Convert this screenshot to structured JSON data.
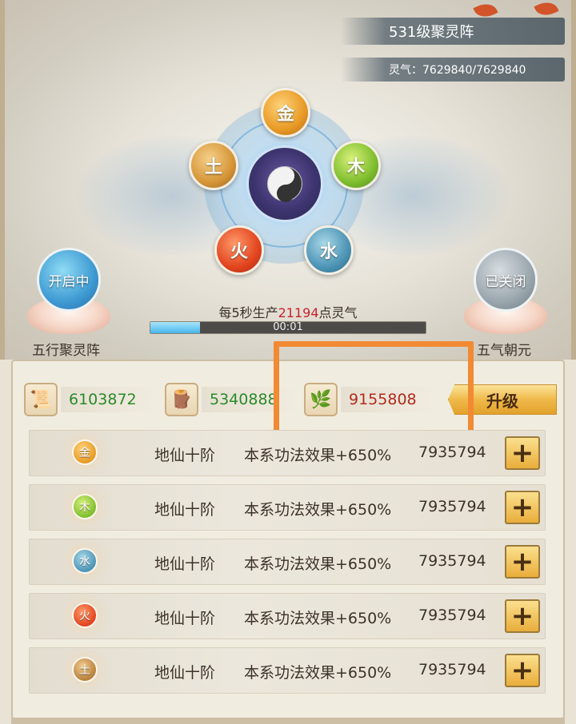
{
  "header": {
    "title": "531级聚灵阵",
    "qi_label": "灵气：7629840/7629840"
  },
  "formation": {
    "center_icon": "yinyang-icon",
    "elements": [
      {
        "key": "gold",
        "label": "金",
        "color": "#e89a25"
      },
      {
        "key": "wood",
        "label": "木",
        "color": "#7fbe2f"
      },
      {
        "key": "water",
        "label": "水",
        "color": "#4d94b5"
      },
      {
        "key": "fire",
        "label": "火",
        "color": "#e2441e"
      },
      {
        "key": "earth",
        "label": "土",
        "color": "#d69638"
      }
    ]
  },
  "left_array": {
    "status": "开启中",
    "name": "五行聚灵阵"
  },
  "right_array": {
    "status": "已关闭",
    "name": "五气朝元"
  },
  "production": {
    "prefix": "每5秒生产",
    "amount": "21194",
    "suffix": "点灵气",
    "timer": "00:01",
    "progress": 0.18
  },
  "resources": [
    {
      "icon": "scroll-icon",
      "value": "6103872",
      "color": "green"
    },
    {
      "icon": "wood-logs-icon",
      "value": "5340888",
      "color": "green"
    },
    {
      "icon": "herb-leaf-icon",
      "value": "9155808",
      "color": "red"
    }
  ],
  "upgrade_label": "升级",
  "rows": [
    {
      "element": "金",
      "rank": "地仙十阶",
      "effect": "本系功法效果+650%",
      "value": "7935794",
      "color": "#e89a25"
    },
    {
      "element": "木",
      "rank": "地仙十阶",
      "effect": "本系功法效果+650%",
      "value": "7935794",
      "color": "#7fbe2f"
    },
    {
      "element": "水",
      "rank": "地仙十阶",
      "effect": "本系功法效果+650%",
      "value": "7935794",
      "color": "#4d94b5"
    },
    {
      "element": "火",
      "rank": "地仙十阶",
      "effect": "本系功法效果+650%",
      "value": "7935794",
      "color": "#e2441e"
    },
    {
      "element": "土",
      "rank": "地仙十阶",
      "effect": "本系功法效果+650%",
      "value": "7935794",
      "color": "#b9803a"
    }
  ],
  "plus_label": "+",
  "highlight_color": "#f28a34"
}
